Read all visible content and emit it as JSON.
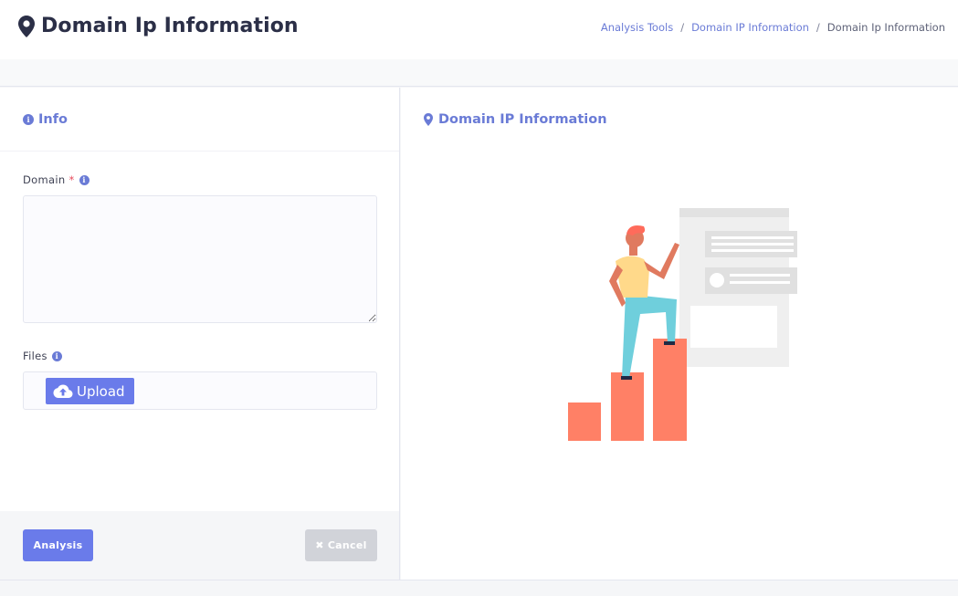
{
  "header": {
    "title": "Domain Ip Information",
    "breadcrumb": [
      {
        "label": "Analysis Tools"
      },
      {
        "label": "Domain IP Information"
      },
      {
        "label": "Domain Ip Information"
      }
    ],
    "separator": "/"
  },
  "left_panel": {
    "title": "Info",
    "domain_field": {
      "label": "Domain",
      "required_mark": "*",
      "value": "",
      "placeholder": ""
    },
    "files_field": {
      "label": "Files",
      "upload_label": "Upload"
    },
    "analysis_label": "Analysis",
    "cancel_label": "Cancel"
  },
  "right_panel": {
    "title": "Domain IP Information"
  },
  "colors": {
    "accent": "#6a7bea",
    "title": "#2b2f47",
    "required": "#e74c5c",
    "bars": "#ff8066",
    "disabled": "#d1d3d9"
  },
  "icons": {
    "title": "map-marker-icon",
    "info": "info-circle-icon",
    "upload": "cloud-upload-icon",
    "cancel": "times-icon"
  }
}
